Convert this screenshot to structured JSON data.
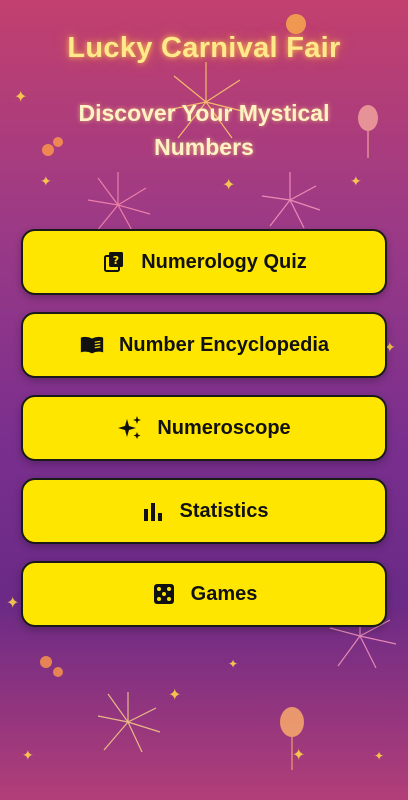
{
  "header": {
    "title": "Lucky Carnival Fair",
    "subtitle": "Discover Your Mystical Numbers"
  },
  "menu": {
    "items": [
      {
        "label": "Numerology Quiz",
        "icon": "quiz-icon"
      },
      {
        "label": "Number Encyclopedia",
        "icon": "book-icon"
      },
      {
        "label": "Numeroscope",
        "icon": "sparkles-icon"
      },
      {
        "label": "Statistics",
        "icon": "bar-chart-icon"
      },
      {
        "label": "Games",
        "icon": "dice-icon"
      }
    ]
  },
  "colors": {
    "button_bg": "#ffe600",
    "button_border": "#1a1a1a",
    "title_glow": "#ffe98a",
    "background_top": "#c2406e",
    "background_mid": "#7a2f8e"
  }
}
